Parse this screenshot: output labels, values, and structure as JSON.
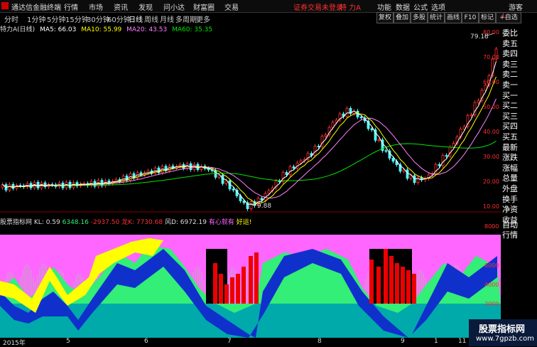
{
  "window": {
    "app_title": "通达信金融终端",
    "menus": [
      "行情",
      "市场",
      "资讯",
      "发现",
      "问小达",
      "财富圈",
      "交易"
    ],
    "alert": "证券交易未登录",
    "stock_tab": "特 力A",
    "right_menus": [
      "功能",
      "数据",
      "公式",
      "选项"
    ],
    "user": "游客"
  },
  "periods": {
    "items": [
      "分时",
      "1分钟",
      "5分钟",
      "15分钟",
      "30分钟",
      "60分钟",
      "日线",
      "周线",
      "月线",
      "多周期",
      "更多"
    ],
    "active": "日线"
  },
  "toolbar": [
    "复权",
    "叠加",
    "多股",
    "统计",
    "画线",
    "F10",
    "标记",
    "+自选"
  ],
  "main_legend": {
    "stock": "特力A(日线)",
    "ma5": "MA5: 66.03",
    "ma10": "MA10: 55.99",
    "ma20": "MA20: 43.53",
    "ma60": "MA60: 35.35"
  },
  "price_axis": [
    "80.00",
    "70.00",
    "60.00",
    "50.00",
    "40.00",
    "30.00",
    "20.00",
    "10.00"
  ],
  "annotations": {
    "high": "79.18",
    "low": "9.88"
  },
  "right_panel": [
    "委比",
    "卖五",
    "卖四",
    "卖三",
    "卖二",
    "卖一",
    "买一",
    "买二",
    "买三",
    "买四",
    "买五",
    "最新",
    "涨跌",
    "涨幅",
    "总量",
    "外盘",
    "换手",
    "净资",
    "收益"
  ],
  "right_panel_top": "L",
  "indicator_legend": {
    "name": "股票指标网",
    "kl": "KL: 0.59",
    "v1": "6348.16",
    "v2": "-2937.50",
    "v3": "龙K: 7730.68",
    "v4": "风D: 6972.19",
    "v5": "有心就有",
    "v6": "好运!"
  },
  "indicator_axis": [
    "8000",
    "6000",
    "4000",
    "2000"
  ],
  "side_buttons": [
    "自动",
    "行情"
  ],
  "bottom_dates": [
    "2015年",
    "5",
    "6",
    "7",
    "8",
    "9",
    "1",
    "11"
  ],
  "watermark": {
    "title": "股票指标网",
    "url": "www.7gpzb.com"
  },
  "colors": {
    "bg": "#000000",
    "up": "#ff3030",
    "down": "#54ffff",
    "ma5": "#ffffff",
    "ma10": "#ffff00",
    "ma20": "#ff80ff",
    "ma60": "#00e600",
    "magenta_fill": "#ff66ff",
    "green_fill": "#33ee77",
    "yellow_fill": "#ffff00",
    "blue_fill": "#1030cc",
    "teal_fill": "#00aaaa"
  }
}
